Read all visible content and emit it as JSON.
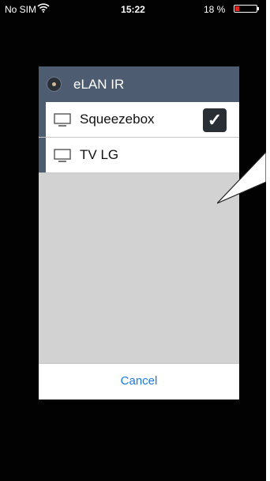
{
  "status_bar": {
    "carrier": "No SIM",
    "time": "15:22",
    "battery_percent": "18 %",
    "battery_level": 0.18,
    "battery_color": "#e0271f"
  },
  "dialog": {
    "title": "eLAN IR",
    "devices": [
      {
        "label": "Squeezebox",
        "checked": true,
        "check_glyph": "✓"
      },
      {
        "label": "TV LG",
        "checked": false
      }
    ],
    "cancel_label": "Cancel"
  },
  "colors": {
    "header": "#4e5c71",
    "accent": "#1a7ae0",
    "dialog_body": "#d2d2d2"
  }
}
